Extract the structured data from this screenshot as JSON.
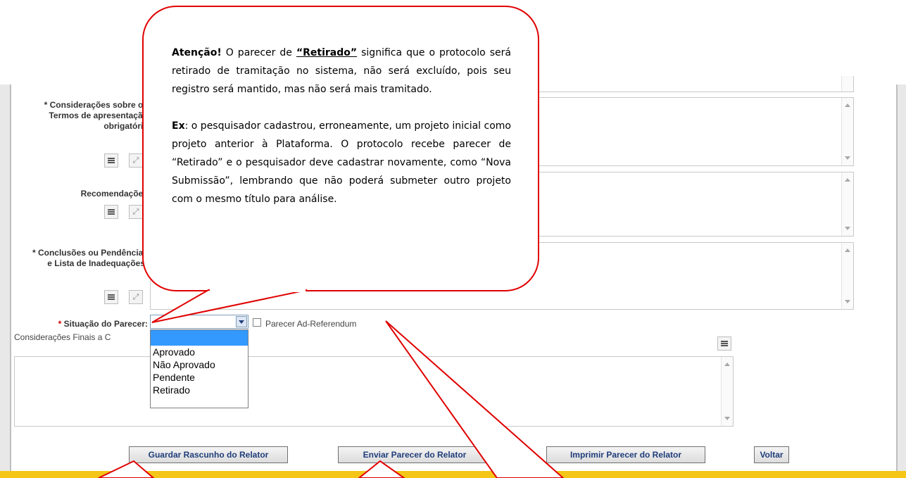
{
  "form": {
    "termos_label": "* Considerações sobre os Termos de apresentação obrigatória",
    "recomendacoes_label": "Recomendações",
    "conclusoes_label": "* Conclusões ou Pendências e Lista de Inadequações:",
    "situacao_label": "Situação do Parecer:",
    "situacao_required": "*",
    "ad_referendum_label": "Parecer Ad-Referendum",
    "consideracoes_finais_label": "Considerações Finais a C"
  },
  "dropdown": {
    "options": [
      "",
      "Aprovado",
      "Não Aprovado",
      "Pendente",
      "Retirado"
    ]
  },
  "buttons": {
    "guardar": "Guardar Rascunho do Relator",
    "enviar": "Enviar Parecer do Relator",
    "imprimir": "Imprimir Parecer do Relator",
    "voltar": "Voltar"
  },
  "callout": {
    "p1_bold": "Atenção!",
    "p1_a": " O parecer de ",
    "p1_quote": "“Retirado”",
    "p1_b": " significa que o protocolo será retirado de tramitação no sistema, não será excluído, pois seu registro será mantido, mas não será mais tramitado.",
    "p2_bold": "Ex",
    "p2_text": ": o pesquisador cadastrou, erroneamente, um projeto inicial como projeto anterior à Plataforma. O protocolo recebe parecer de “Retirado” e o pesquisador deve cadastrar novamente, como “Nova Submissão”, lembrando que não poderá submeter outro projeto com o mesmo título para análise."
  },
  "colors": {
    "callout_border": "#e00000",
    "required": "#d00000",
    "button_text": "#1f3d7a",
    "bottom_bar": "#f5c518"
  }
}
